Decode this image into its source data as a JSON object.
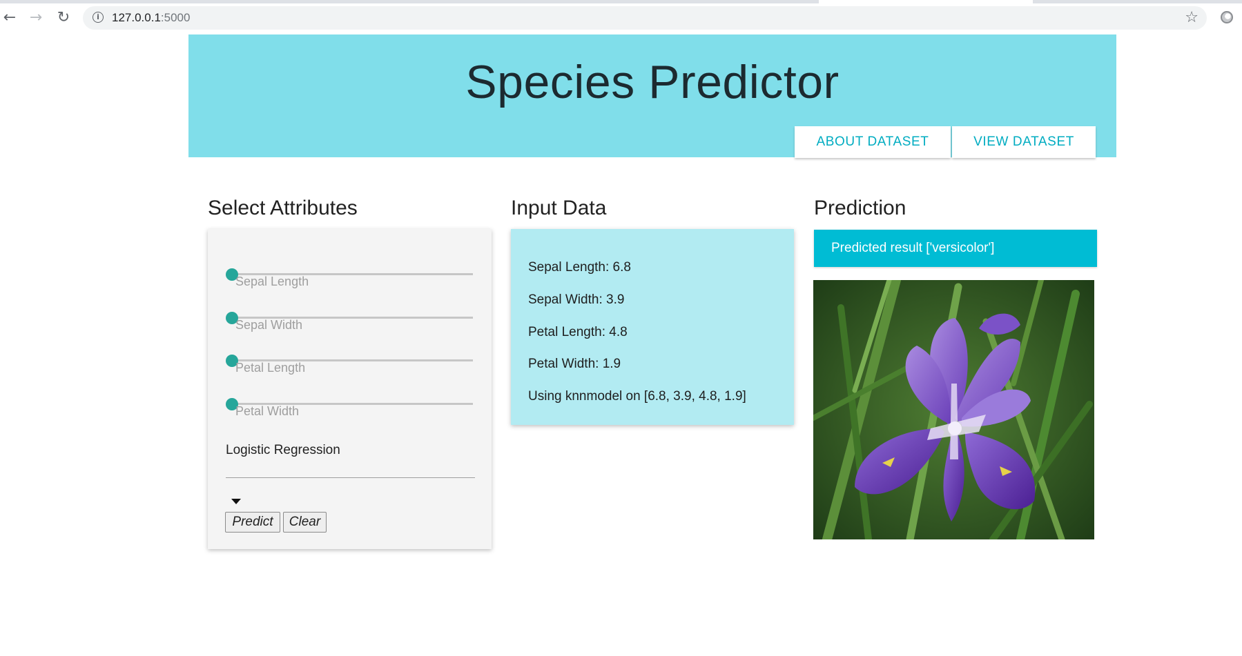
{
  "browser": {
    "url_host": "127.0.0.1",
    "url_port": ":5000"
  },
  "header": {
    "title": "Species Predictor",
    "about_label": "ABOUT DATASET",
    "view_label": "VIEW DATASET"
  },
  "attributes": {
    "title": "Select Attributes",
    "sliders": [
      {
        "label": "Sepal Length"
      },
      {
        "label": "Sepal Width"
      },
      {
        "label": "Petal Length"
      },
      {
        "label": "Petal Width"
      }
    ],
    "model_selected": "Logistic Regression",
    "predict_label": "Predict",
    "clear_label": "Clear"
  },
  "input_data": {
    "title": "Input Data",
    "rows": [
      "Sepal Length: 6.8",
      "Sepal Width: 3.9",
      "Petal Length: 4.8",
      "Petal Width: 1.9",
      "Using knnmodel on [6.8, 3.9, 4.8, 1.9]"
    ]
  },
  "prediction": {
    "title": "Prediction",
    "result": "Predicted result ['versicolor']"
  },
  "colors": {
    "header_bg": "#80deea",
    "accent": "#00bcd4",
    "input_bg": "#b2ebf2",
    "slider_thumb": "#26a69a"
  }
}
